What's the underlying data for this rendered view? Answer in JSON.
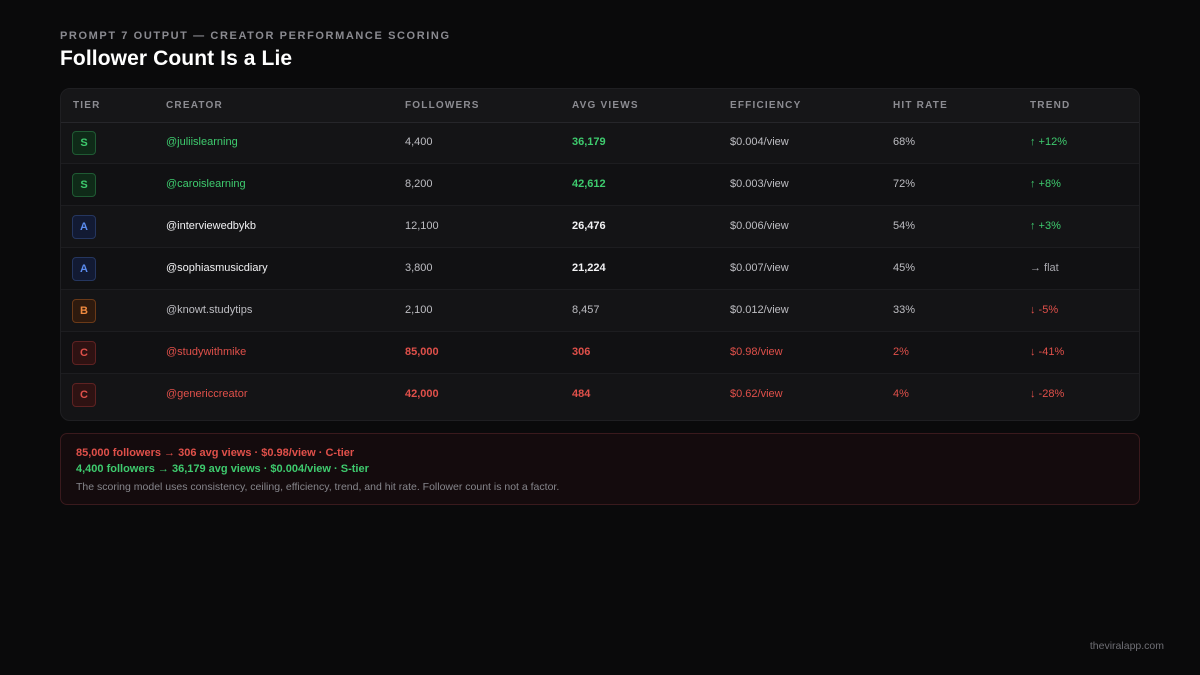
{
  "header": {
    "eyebrow": "PROMPT 7 OUTPUT — CREATOR PERFORMANCE SCORING",
    "title": "Follower Count Is a Lie"
  },
  "table": {
    "columns": [
      "TIER",
      "CREATOR",
      "FOLLOWERS",
      "AVG VIEWS",
      "EFFICIENCY",
      "HIT RATE",
      "TREND"
    ],
    "rows": [
      {
        "tier": "S",
        "creator": "@juliislearning",
        "followers": "4,400",
        "avg_views": "36,179",
        "efficiency": "$0.004/view",
        "hit_rate": "68%",
        "trend": "↑ +12%",
        "trend_dir": "up",
        "tone": "good"
      },
      {
        "tier": "S",
        "creator": "@caroislearning",
        "followers": "8,200",
        "avg_views": "42,612",
        "efficiency": "$0.003/view",
        "hit_rate": "72%",
        "trend": "↑ +8%",
        "trend_dir": "up",
        "tone": "good"
      },
      {
        "tier": "A",
        "creator": "@interviewedbykb",
        "followers": "12,100",
        "avg_views": "26,476",
        "efficiency": "$0.006/view",
        "hit_rate": "54%",
        "trend": "↑ +3%",
        "trend_dir": "up",
        "tone": "strong"
      },
      {
        "tier": "A",
        "creator": "@sophiasmusicdiary",
        "followers": "3,800",
        "avg_views": "21,224",
        "efficiency": "$0.007/view",
        "hit_rate": "45%",
        "trend": "→ flat",
        "trend_dir": "flat",
        "tone": "strong"
      },
      {
        "tier": "B",
        "creator": "@knowt.studytips",
        "followers": "2,100",
        "avg_views": "8,457",
        "efficiency": "$0.012/view",
        "hit_rate": "33%",
        "trend": "↓ -5%",
        "trend_dir": "down",
        "tone": "neutral"
      },
      {
        "tier": "C",
        "creator": "@studywithmike",
        "followers": "85,000",
        "avg_views": "306",
        "efficiency": "$0.98/view",
        "hit_rate": "2%",
        "trend": "↓ -41%",
        "trend_dir": "down",
        "tone": "bad"
      },
      {
        "tier": "C",
        "creator": "@genericcreator",
        "followers": "42,000",
        "avg_views": "484",
        "efficiency": "$0.62/view",
        "hit_rate": "4%",
        "trend": "↓ -28%",
        "trend_dir": "down",
        "tone": "bad"
      }
    ]
  },
  "callout": {
    "line1": "85,000 followers → 306 avg views · $0.98/view · C-tier",
    "line2": "4,400 followers → 36,179 avg views · $0.004/view · S-tier",
    "note": "The scoring model uses consistency, ceiling, efficiency, trend, and hit rate. Follower count is not a factor."
  },
  "footer": {
    "brand": "theviralapp.com"
  },
  "colors": {
    "background": "#0a0a0b",
    "good": "#3ecb6e",
    "bad": "#e0504a",
    "tier_a": "#5b8cf0",
    "tier_b": "#f08a40"
  }
}
